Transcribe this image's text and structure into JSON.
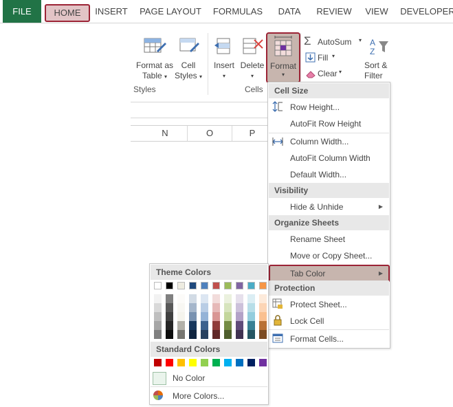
{
  "tabs": [
    "FILE",
    "HOME",
    "INSERT",
    "PAGE LAYOUT",
    "FORMULAS",
    "DATA",
    "REVIEW",
    "VIEW",
    "DEVELOPER"
  ],
  "ribbon": {
    "format_as_table": [
      "Format as",
      "Table"
    ],
    "cell_styles": [
      "Cell",
      "Styles"
    ],
    "styles_group": "Styles",
    "insert": "Insert",
    "delete": "Delete",
    "format": "Format",
    "cells_group": "Cells",
    "autosum": "AutoSum",
    "fill": "Fill",
    "clear": "Clear",
    "sort_filter": [
      "Sort &",
      "Filter"
    ]
  },
  "columns": [
    "N",
    "O",
    "P"
  ],
  "menu": {
    "cell_size": "Cell Size",
    "row_height": "Row Height...",
    "autofit_row_height": "AutoFit Row Height",
    "column_width": "Column Width...",
    "autofit_column_width": "AutoFit Column Width",
    "default_width": "Default Width...",
    "visibility": "Visibility",
    "hide_unhide": "Hide & Unhide",
    "organize_sheets": "Organize Sheets",
    "rename_sheet": "Rename Sheet",
    "move_copy_sheet": "Move or Copy Sheet...",
    "tab_color": "Tab Color",
    "protection": "Protection",
    "protect_sheet": "Protect Sheet...",
    "lock_cell": "Lock Cell",
    "format_cells": "Format Cells..."
  },
  "palette": {
    "theme_colors_label": "Theme Colors",
    "theme_colors": [
      "#ffffff",
      "#000000",
      "#eeece1",
      "#1f497d",
      "#4f81bd",
      "#c0504d",
      "#9bbb59",
      "#8064a2",
      "#4bacc6",
      "#f79646"
    ],
    "standard_colors_label": "Standard Colors",
    "standard_colors": [
      "#c00000",
      "#ff0000",
      "#ffc000",
      "#ffff00",
      "#92d050",
      "#00b050",
      "#00b0f0",
      "#0070c0",
      "#002060",
      "#7030a0"
    ],
    "no_color": "No Color",
    "more_colors": "More Colors..."
  },
  "colors": {
    "excel_green": "#217346",
    "highlight": "#9b2335"
  }
}
